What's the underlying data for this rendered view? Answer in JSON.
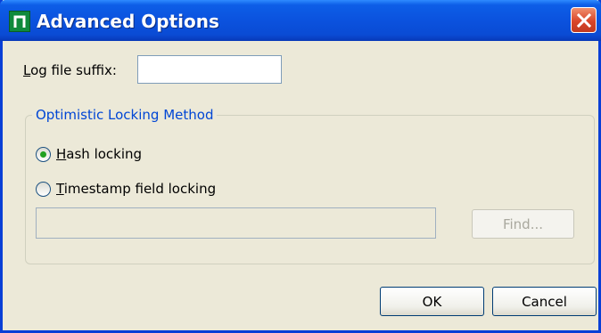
{
  "window": {
    "title": "Advanced Options",
    "icon": "app-n-icon",
    "close_icon": "close-icon"
  },
  "log_suffix": {
    "label_mnemonic": "L",
    "label_rest": "og file suffix:",
    "value": ""
  },
  "locking_group": {
    "legend": "Optimistic Locking Method",
    "options": [
      {
        "mnemonic": "H",
        "rest": "ash locking",
        "selected": true
      },
      {
        "mnemonic": "T",
        "rest": "imestamp field locking",
        "selected": false
      }
    ],
    "timestamp_field_value": "",
    "find_label": "Find..."
  },
  "footer": {
    "ok_label": "OK",
    "cancel_label": "Cancel"
  },
  "colors": {
    "titlebar": "#0b52de",
    "legend_text": "#0046d5",
    "radio_selected_dot": "#21a121",
    "close_button": "#d9462a"
  }
}
